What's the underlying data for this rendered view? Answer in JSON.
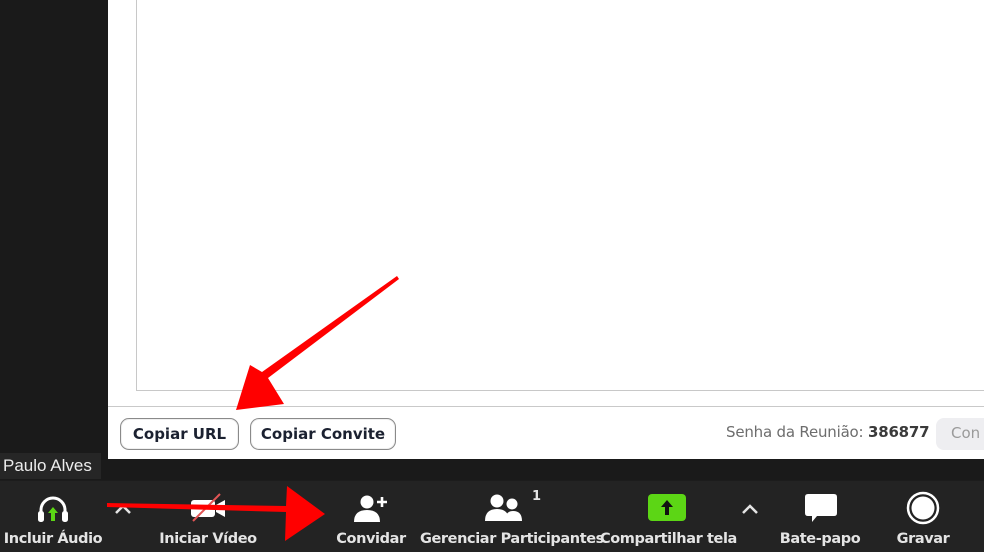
{
  "invite_panel": {
    "copy_url_label": "Copiar URL",
    "copy_invite_label": "Copiar Convite",
    "password_label": "Senha da Reunião:",
    "password_value": "386877",
    "truncated_button_label": "Con"
  },
  "participant": {
    "name": "Paulo Alves"
  },
  "toolbar": {
    "audio_label": "Incluir Áudio",
    "video_label": "Iniciar Vídeo",
    "invite_label": "Convidar",
    "participants_label": "Gerenciar Participantes",
    "participants_count": "1",
    "share_label": "Compartilhar tela",
    "chat_label": "Bate-papo",
    "record_label": "Gravar"
  },
  "colors": {
    "share_green": "#5cd615",
    "audio_arrow_green": "#5cd615",
    "annotation_red": "#ff0000",
    "toolbar_bg": "#232323"
  },
  "icons": {
    "audio": "headphones-icon",
    "video": "video-off-icon",
    "invite": "add-user-icon",
    "participants": "participants-icon",
    "share": "share-screen-icon",
    "chat": "chat-bubble-icon",
    "record": "record-icon"
  }
}
